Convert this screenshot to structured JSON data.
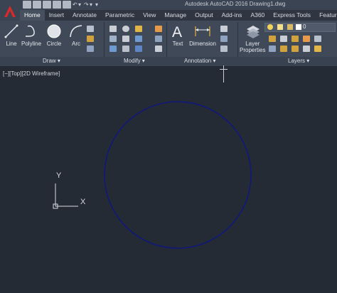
{
  "window": {
    "title": "Autodesk AutoCAD 2016   Drawing1.dwg"
  },
  "tabs": [
    "Home",
    "Insert",
    "Annotate",
    "Parametric",
    "View",
    "Manage",
    "Output",
    "Add-ins",
    "A360",
    "Express Tools",
    "Featured A"
  ],
  "active_tab": "Home",
  "draw_tools": [
    {
      "label": "Line",
      "icon": "line-icon"
    },
    {
      "label": "Polyline",
      "icon": "polyline-icon"
    },
    {
      "label": "Circle",
      "icon": "circle-icon"
    },
    {
      "label": "Arc",
      "icon": "arc-icon"
    }
  ],
  "annotation_tools": [
    {
      "label": "Text",
      "icon": "text-icon"
    },
    {
      "label": "Dimension",
      "icon": "dimension-icon"
    }
  ],
  "layer_tools": [
    {
      "label_line1": "Layer",
      "label_line2": "Properties",
      "icon": "layer-properties-icon"
    }
  ],
  "layer_dropdown": {
    "value": "0"
  },
  "panels": [
    "Draw",
    "Modify",
    "Annotation",
    "Layers"
  ],
  "panel_suffix": "▾",
  "viewport": {
    "label": "[−][Top][2D Wireframe]"
  },
  "ucs": {
    "x_label": "X",
    "y_label": "Y"
  },
  "colors": {
    "background": "#252b34",
    "circle": "#10187a",
    "ribbon": "#404958",
    "ucs": "#d6dae0"
  }
}
